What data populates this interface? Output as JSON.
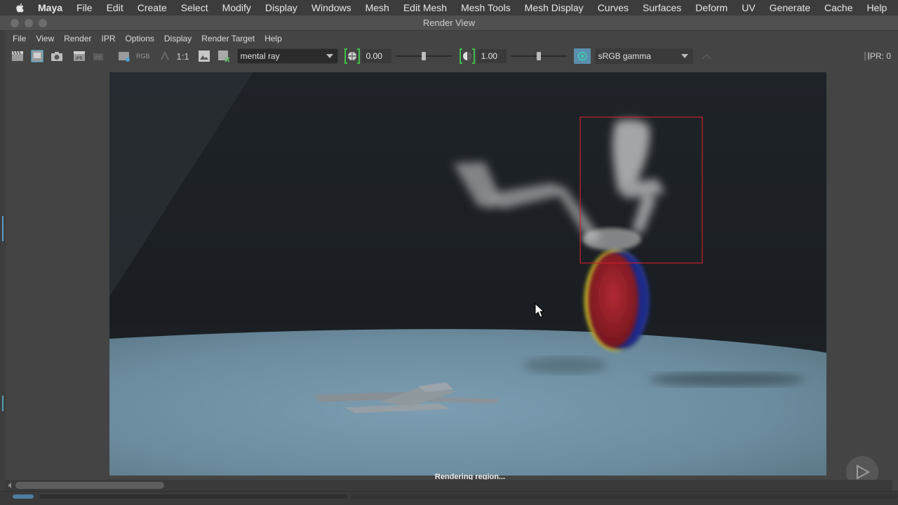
{
  "menubar": {
    "app_name": "Maya",
    "items": [
      "File",
      "Edit",
      "Create",
      "Select",
      "Modify",
      "Display",
      "Windows",
      "Mesh",
      "Edit Mesh",
      "Mesh Tools",
      "Mesh Display",
      "Curves",
      "Surfaces",
      "Deform",
      "UV",
      "Generate",
      "Cache",
      "Help"
    ]
  },
  "window": {
    "title": "Render View"
  },
  "panel_menu": {
    "items": [
      "File",
      "View",
      "Render",
      "IPR",
      "Options",
      "Display",
      "Render Target",
      "Help"
    ]
  },
  "toolbar": {
    "rgb_label": "RGB",
    "one_to_one_label": "1:1",
    "renderer": "mental ray",
    "exposure_value": "0.00",
    "exposure_level": 0.0,
    "gamma_value": "1.00",
    "gamma_level": 1.0,
    "color_space": "sRGB gamma",
    "ipr_label": "IPR: 0",
    "icons": [
      "clapboard-icon",
      "region-render-icon",
      "snapshot-icon",
      "ipr-clapboard-icon",
      "ipr-refresh-icon",
      "render-settings-icon",
      "rgb-channel-icon",
      "alpha-icon",
      "one-to-one-icon",
      "display-real-size-icon",
      "remove-image-icon",
      "exposure-icon",
      "gamma-icon",
      "color-management-icon"
    ]
  },
  "status": {
    "message": "Rendering region..."
  },
  "colors": {
    "background": "#444444",
    "render_bg": "#1c2126",
    "floor": "#6d8ea3",
    "region_box": "#c8202a",
    "ball_red": "#8e1e28",
    "ball_blue": "#1f2a8a",
    "ball_yellow": "#c9c52a",
    "ocio_accent": "#5b8fae"
  }
}
